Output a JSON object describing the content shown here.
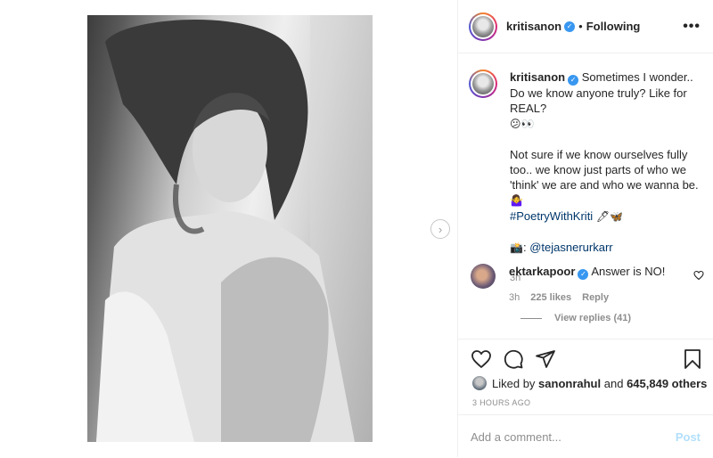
{
  "header": {
    "username": "kritisanon",
    "separator": "•",
    "follow_status": "Following",
    "more_glyph": "•••"
  },
  "media": {
    "next_glyph": "›"
  },
  "caption": {
    "username": "kritisanon",
    "line1": "Sometimes I wonder.. Do we know anyone truly? Like for REAL?",
    "emoji1": "😕👀",
    "line2": "Not sure if we know ourselves fully too.. we know just parts of who we 'think' we are and who we wanna be.",
    "emoji2": "🤷‍♀️",
    "hashtag": "#PoetryWithKriti",
    "emoji3": "🖊🦋",
    "credit_emoji": "📸",
    "credit_sep": ":",
    "credit_handle": "@tejasnerurkarr",
    "time": "3h"
  },
  "comment": {
    "username": "ektarkapoor",
    "text": "Answer is NO!",
    "time": "3h",
    "likes": "225 likes",
    "reply": "Reply",
    "view_replies": "View replies (41)"
  },
  "likes": {
    "prefix": "Liked by",
    "user": "sanonrahul",
    "conjunction": "and",
    "others": "645,849 others"
  },
  "posted_time": "3 HOURS AGO",
  "comment_box": {
    "placeholder": "Add a comment...",
    "post_label": "Post"
  },
  "icons": [
    "heart-icon",
    "comment-icon",
    "share-icon",
    "save-icon",
    "more-icon",
    "verified-icon",
    "chevron-right-icon"
  ],
  "colors": {
    "verified": "#3897f0",
    "link": "#00376b",
    "muted": "#8e8e8e",
    "post_disabled": "#b2dffc"
  }
}
